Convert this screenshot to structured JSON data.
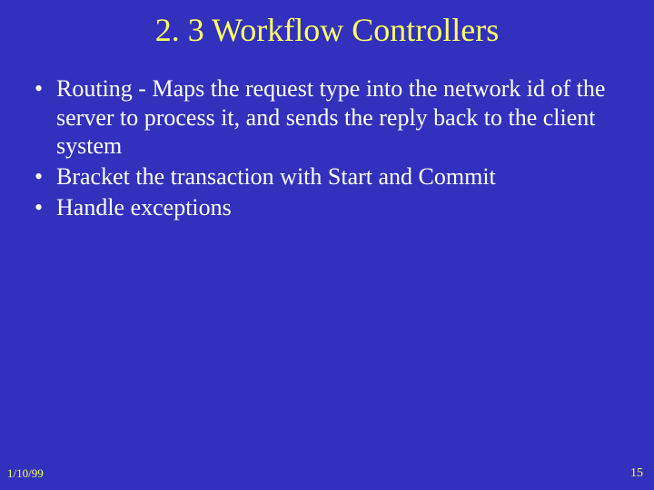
{
  "slide": {
    "title": "2. 3 Workflow Controllers",
    "bullets": [
      "Routing - Maps the request type into the network id of the server to process it, and sends the reply back to the client system",
      "Bracket the transaction with Start and Commit",
      "Handle exceptions"
    ],
    "footer_date": "1/10/99",
    "footer_page": "15"
  }
}
